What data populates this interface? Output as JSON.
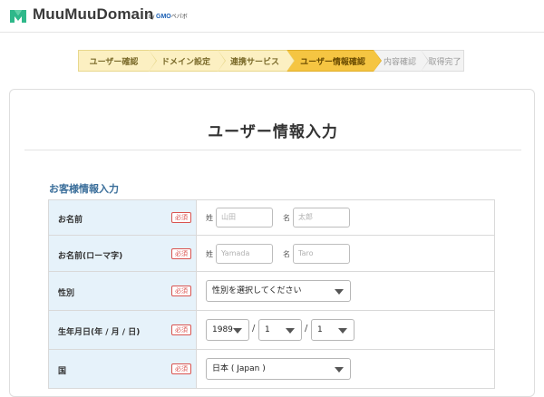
{
  "header": {
    "logo_text": "MuuMuuDomain",
    "logo_by": "by",
    "logo_company": "GMO",
    "logo_company_rest": "ペパボ"
  },
  "steps": [
    {
      "label": "ユーザー確認",
      "state": "done"
    },
    {
      "label": "ドメイン設定",
      "state": "done"
    },
    {
      "label": "連携サービス",
      "state": "done"
    },
    {
      "label": "ユーザー情報確認",
      "state": "active"
    },
    {
      "label": "内容確認",
      "state": "future"
    },
    {
      "label": "取得完了",
      "state": "future"
    }
  ],
  "page": {
    "title": "ユーザー情報入力",
    "section_title": "お客様情報入力"
  },
  "form": {
    "required_badge": "必須",
    "name": {
      "label": "お名前",
      "last_label": "姓",
      "last_placeholder": "山田",
      "first_label": "名",
      "first_placeholder": "太郎"
    },
    "name_roman": {
      "label": "お名前(ローマ字)",
      "last_label": "姓",
      "last_placeholder": "Yamada",
      "first_label": "名",
      "first_placeholder": "Taro"
    },
    "gender": {
      "label": "性別",
      "value": "性別を選択してください"
    },
    "birthday": {
      "label": "生年月日(年 / 月 / 日)",
      "year": "1989",
      "month": "1",
      "day": "1",
      "separator": "/"
    },
    "country": {
      "label": "国",
      "value": "日本 ( Japan )"
    }
  },
  "colors": {
    "accent_blue": "#3a6e9a",
    "label_bg": "#e6f2fa",
    "step_done": "#fcf0c2",
    "step_active": "#f5c542",
    "required_red": "#d9534f",
    "logo_green": "#2fb88a"
  }
}
